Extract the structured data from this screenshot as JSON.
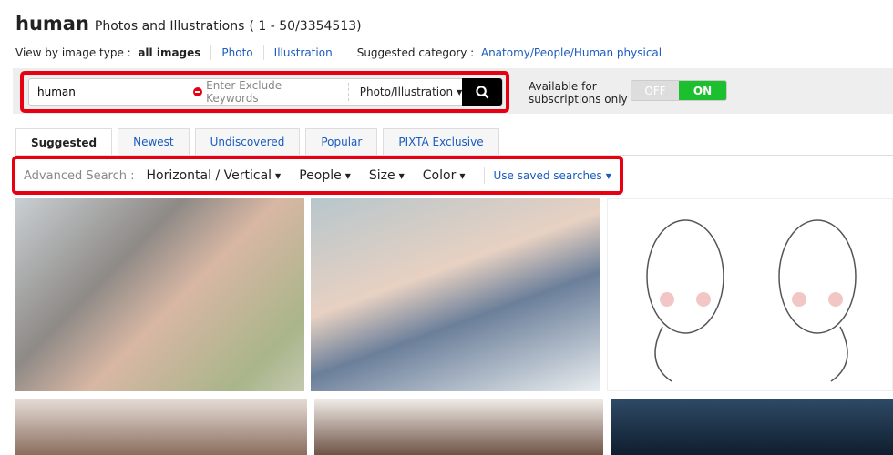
{
  "header": {
    "keyword": "human",
    "subtitle": "Photos and Illustrations",
    "count": "( 1 - 50/3354513)"
  },
  "type_row": {
    "label": "View by image type :",
    "all": "all images",
    "photo": "Photo",
    "illustration": "Illustration",
    "category_label": "Suggested category :",
    "category": "Anatomy/People/Human physical"
  },
  "search": {
    "value": "human",
    "exclude_placeholder": "Enter Exclude Keywords",
    "type": "Photo/Illustration"
  },
  "subscription": {
    "label_line1": "Available for",
    "label_line2": "subscriptions only",
    "off": "OFF",
    "on": "ON",
    "state": "on",
    "on_color": "#1cc02f"
  },
  "tabs": [
    {
      "label": "Suggested"
    },
    {
      "label": "Newest"
    },
    {
      "label": "Undiscovered"
    },
    {
      "label": "Popular"
    },
    {
      "label": "PIXTA Exclusive"
    }
  ],
  "filters": {
    "label": "Advanced Search :",
    "items": [
      "Horizontal / Vertical",
      "People",
      "Size",
      "Color"
    ],
    "saved": "Use saved searches"
  },
  "highlight_color": "#e60012"
}
